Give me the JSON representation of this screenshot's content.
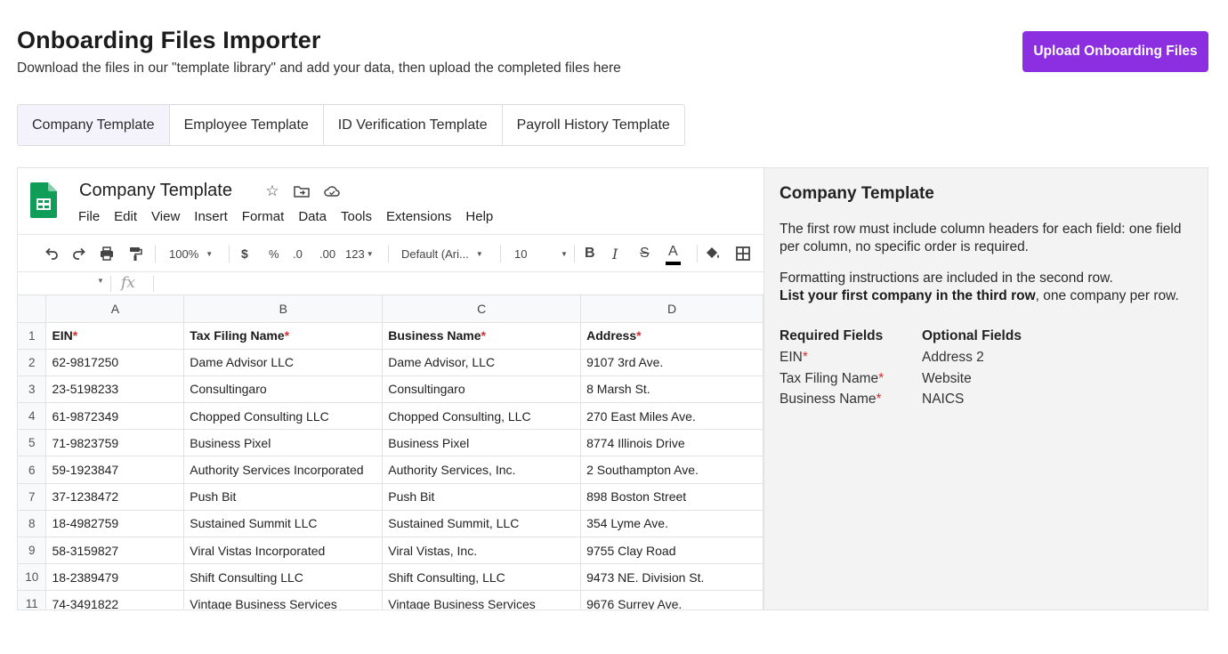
{
  "header": {
    "title": "Onboarding Files Importer",
    "subtitle": "Download the files in our \"template library\" and add your data, then upload the completed files here",
    "upload_label": "Upload Onboarding Files"
  },
  "tabs": [
    {
      "label": "Company Template",
      "active": true
    },
    {
      "label": "Employee Template",
      "active": false
    },
    {
      "label": "ID Verification Template",
      "active": false
    },
    {
      "label": "Payroll History Template",
      "active": false
    }
  ],
  "sheet": {
    "title": "Company Template",
    "menu": [
      "File",
      "Edit",
      "View",
      "Insert",
      "Format",
      "Data",
      "Tools",
      "Extensions",
      "Help"
    ],
    "toolbar": {
      "zoom": "100%",
      "currency": "$",
      "percent": "%",
      "decrease_decimals": ".0",
      "increase_decimals": ".00",
      "more_formats": "123",
      "font": "Default (Ari...",
      "font_size": "10",
      "bold": "B",
      "italic": "I",
      "strike": "S",
      "text_color": "A"
    },
    "fx_label": "fx",
    "columns": [
      "A",
      "B",
      "C",
      "D"
    ],
    "header_row": [
      "EIN",
      "Tax Filing Name",
      "Business Name",
      "Address"
    ],
    "required_marker": "*",
    "rows": [
      [
        "62-9817250",
        "Dame Advisor LLC",
        "Dame Advisor, LLC",
        "9107 3rd Ave."
      ],
      [
        "23-5198233",
        "Consultingaro",
        "Consultingaro",
        "8 Marsh St."
      ],
      [
        "61-9872349",
        "Chopped Consulting LLC",
        "Chopped Consulting, LLC",
        "270 East Miles Ave."
      ],
      [
        "71-9823759",
        "Business Pixel",
        "Business Pixel",
        "8774 Illinois Drive"
      ],
      [
        "59-1923847",
        "Authority Services Incorporated",
        "Authority Services, Inc.",
        "2 Southampton Ave."
      ],
      [
        "37-1238472",
        "Push Bit",
        "Push Bit",
        "898 Boston Street"
      ],
      [
        "18-4982759",
        "Sustained Summit LLC",
        "Sustained Summit, LLC",
        "354 Lyme Ave."
      ],
      [
        "58-3159827",
        "Viral Vistas Incorporated",
        "Viral Vistas, Inc.",
        "9755 Clay Road"
      ],
      [
        "18-2389479",
        "Shift Consulting LLC",
        "Shift Consulting, LLC",
        "9473 NE. Division St."
      ],
      [
        "74-3491822",
        "Vintage Business Services",
        "Vintage Business Services",
        "9676 Surrey Ave."
      ]
    ],
    "row_numbers": [
      "1",
      "2",
      "3",
      "4",
      "5",
      "6",
      "7",
      "8",
      "9",
      "10",
      "11"
    ]
  },
  "side_panel": {
    "title": "Company Template",
    "para1": "The first row must include column headers for each field: one field per column, no specific order is required.",
    "para2_a": "Formatting instructions are included in the second row.",
    "para2_bold": "List your first company in the third row",
    "para2_b": ", one company per row.",
    "required_title": "Required Fields",
    "required_fields": [
      "EIN",
      "Tax Filing Name",
      "Business Name"
    ],
    "optional_title": "Optional Fields",
    "optional_fields": [
      "Address 2",
      "Website",
      "NAICS"
    ]
  },
  "colors": {
    "accent": "#8b2fe0",
    "required": "#d32f2f",
    "sheets_green": "#0f9d58"
  }
}
